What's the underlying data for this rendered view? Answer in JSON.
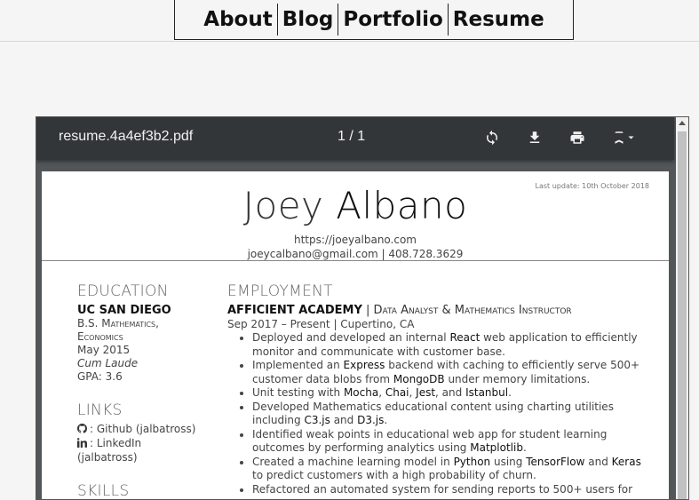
{
  "nav": {
    "items": [
      "About",
      "Blog",
      "Portfolio",
      "Resume"
    ]
  },
  "viewer": {
    "filename": "resume.4a4ef3b2.pdf",
    "page_count": "1 / 1",
    "icons": [
      "rotate-icon",
      "download-icon",
      "print-icon",
      "bookmark-icon"
    ]
  },
  "resume": {
    "last_update": "Last update: 10th October 2018",
    "first_name": "Joey",
    "last_name": "Albano",
    "website": "https://joeyalbano.com",
    "contact": "joeycalbano@gmail.com | 408.728.3629",
    "education": {
      "heading": "EDUCATION",
      "school": "UC SAN DIEGO",
      "degree": "B.S. Mathematics, Economics",
      "date": "May 2015",
      "honors": "Cum Laude",
      "gpa": "GPA: 3.6"
    },
    "links": {
      "heading": "LINKS",
      "github": ": Github (jalbatross)",
      "linkedin": ": LinkedIn (jalbatross)"
    },
    "skills": {
      "heading": "SKILLS"
    },
    "employment": {
      "heading": "EMPLOYMENT",
      "company": "AFFICIENT ACADEMY",
      "role": "| Data Analyst & Mathematics Instructor",
      "dates": "Sep 2017 – Present | Cupertino, CA",
      "bullets": [
        [
          "Deployed and developed an internal ",
          "React",
          " web application to efficiently monitor and communicate with customer base."
        ],
        [
          "Implemented an ",
          "Express",
          " backend with caching to efficiently serve 500+ customer data blobs from ",
          "MongoDB",
          " under memory limitations."
        ],
        [
          "Unit testing with ",
          "Mocha",
          ", ",
          "Chai",
          ", ",
          "Jest",
          ", and ",
          "Istanbul",
          "."
        ],
        [
          "Developed Mathematics educational content using charting utilities including ",
          "C3.js",
          " and ",
          "D3.js",
          "."
        ],
        [
          "Identified weak points in educational web app for student learning outcomes by performing analytics using ",
          "Matplotlib",
          "."
        ],
        [
          "Created a machine learning model in ",
          "Python",
          " using ",
          "TensorFlow",
          " and ",
          "Keras",
          " to predict customers with a high probability of churn."
        ],
        [
          "Refactored an automated system for sending reports to 500+ users for"
        ]
      ]
    }
  }
}
